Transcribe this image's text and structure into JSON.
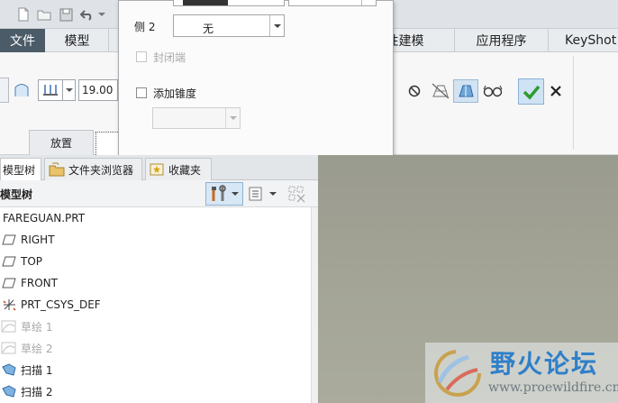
{
  "menu": {
    "file": "文件",
    "model": "模型",
    "flexible": "柔性建模",
    "apps": "应用程序",
    "keyshot": "KeyShot"
  },
  "ribbon": {
    "thickness_value": "19.00",
    "placement_tab": "放置"
  },
  "dialog": {
    "side2_label": "侧 2",
    "side2_value": "无",
    "close_ends_label": "封闭端",
    "add_taper_label": "添加锥度",
    "taper_value": ""
  },
  "panel_tabs": {
    "model_tree": "模型树",
    "folder_browser": "文件夹浏览器",
    "favorites": "收藏夹"
  },
  "tree": {
    "header": "模型树",
    "items": [
      {
        "label": "FAREGUAN.PRT",
        "icon": "part-icon",
        "dimmed": false
      },
      {
        "label": "RIGHT",
        "icon": "datum-plane-icon",
        "dimmed": false
      },
      {
        "label": "TOP",
        "icon": "datum-plane-icon",
        "dimmed": false
      },
      {
        "label": "FRONT",
        "icon": "datum-plane-icon",
        "dimmed": false
      },
      {
        "label": "PRT_CSYS_DEF",
        "icon": "csys-icon",
        "dimmed": false
      },
      {
        "label": "草绘 1",
        "icon": "sketch-icon",
        "dimmed": true
      },
      {
        "label": "草绘 2",
        "icon": "sketch-icon",
        "dimmed": true
      },
      {
        "label": "扫描 1",
        "icon": "sweep-icon",
        "dimmed": false
      },
      {
        "label": "扫描 2",
        "icon": "sweep-icon",
        "dimmed": false
      }
    ]
  },
  "watermark": {
    "title": "野火论坛",
    "url": "www.proewildfire.cn"
  },
  "colors": {
    "accent_file_tab": "#4b5b68",
    "confirm_green": "#2f9a2f",
    "watermark_blue": "#2f7fc9"
  }
}
